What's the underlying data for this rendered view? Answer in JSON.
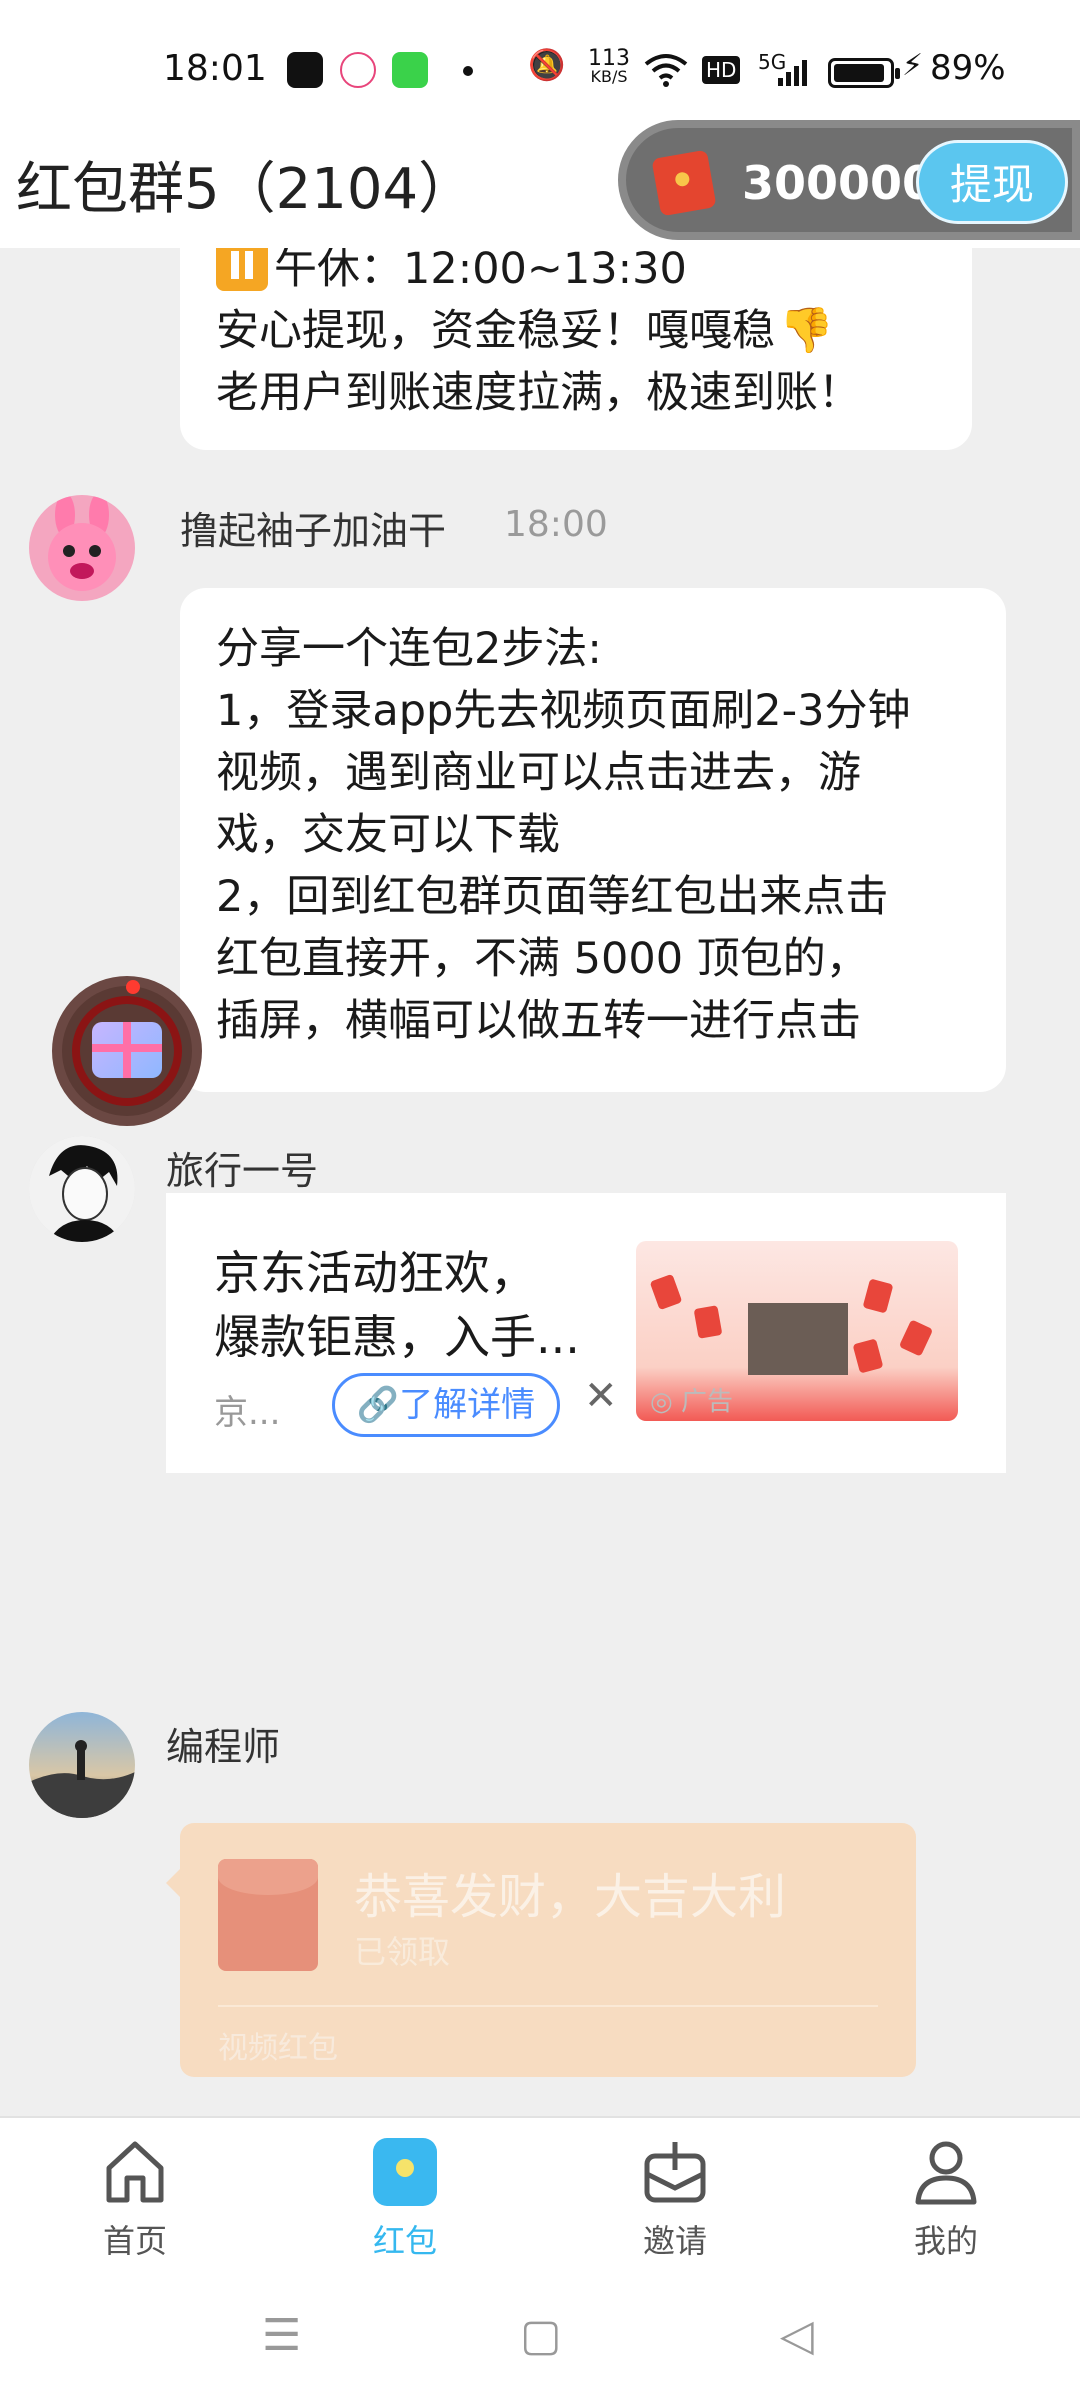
{
  "status_bar": {
    "time": "18:01",
    "network_speed_value": "113",
    "network_speed_unit": "KB/S",
    "network_type": "5G",
    "hd_label": "HD",
    "battery": "89%"
  },
  "header": {
    "title": "红包群5（2104）",
    "balance": "300000",
    "withdraw_label": "提现"
  },
  "messages": [
    {
      "lines": [
        "午休：12:00~13:30",
        "安心提现，资金稳妥！嘎嘎稳",
        "老用户到账速度拉满，极速到账！"
      ]
    },
    {
      "sender": "撸起袖子加油干",
      "time": "18:00",
      "lines": [
        "分享一个连包2步法:",
        "1，登录app先去视频页面刷2-3分钟",
        "视频，遇到商业可以点击进去，游",
        "戏，交友可以下载",
        "2，回到红包群页面等红包出来点击",
        "红包直接开，不满 5000 顶包的，",
        "插屏，横幅可以做五转一进行点击"
      ]
    },
    {
      "sender": "旅行一号",
      "ad": {
        "text_line1": "京东活动狂欢，",
        "text_line2": "爆款钜惠，入手...",
        "source": "京...",
        "button_label": "了解详情",
        "ad_tag": "广告"
      }
    },
    {
      "sender": "编程师",
      "red_packet": {
        "title": "恭喜发财，大吉大利",
        "status": "已领取",
        "type": "视频红包"
      }
    }
  ],
  "bottom_nav": [
    {
      "label": "首页",
      "icon": "home-icon"
    },
    {
      "label": "红包",
      "icon": "red-packet-icon"
    },
    {
      "label": "邀请",
      "icon": "invite-icon"
    },
    {
      "label": "我的",
      "icon": "profile-icon"
    }
  ],
  "colors": {
    "accent": "#35b8ef",
    "packet_bg": "#f7dcc1",
    "chat_bg": "#efefef"
  }
}
